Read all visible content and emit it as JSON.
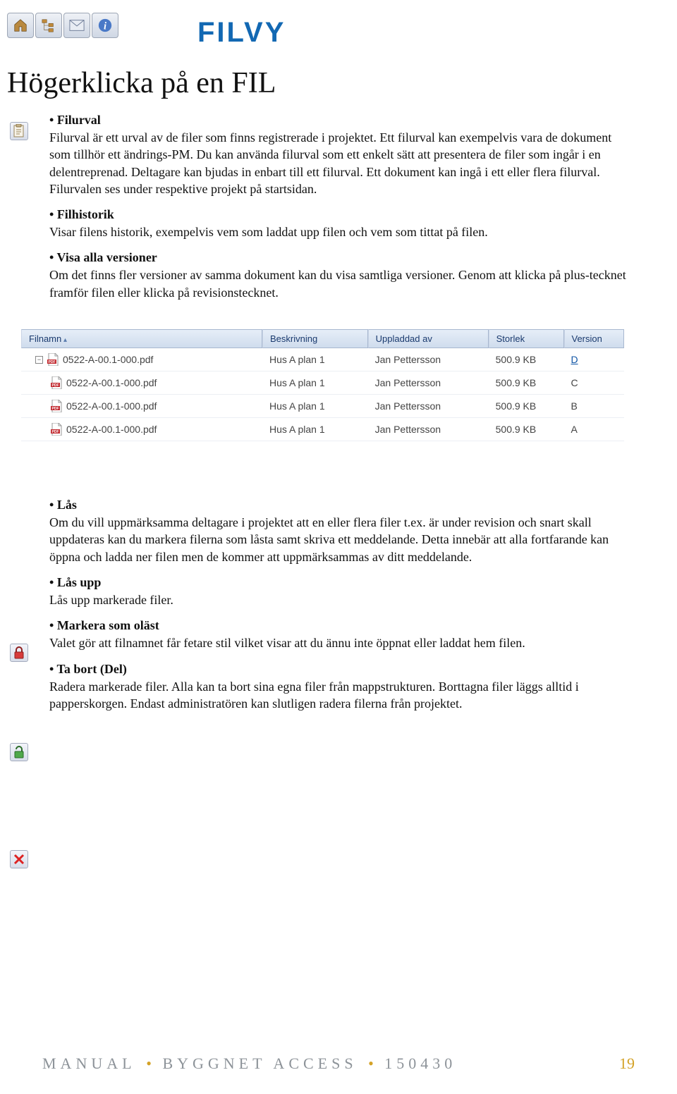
{
  "header": {
    "title": "FILVY"
  },
  "h1": "Högerklicka på en FIL",
  "sections": [
    {
      "title": "Filurval",
      "body": "Filurval är ett urval av de filer som finns registrerade i projektet. Ett filurval kan exempelvis vara de dokument som tillhör ett ändrings-PM. Du kan använda filurval som ett enkelt sätt att presentera de filer som ingår i en delentreprenad. Deltagare kan bjudas in enbart till ett filurval. Ett dokument kan ingå i ett eller flera filurval. Filurvalen ses under respektive projekt på startsidan."
    },
    {
      "title": "Filhistorik",
      "body": "Visar filens historik, exempelvis vem som laddat upp filen och vem som tittat på filen."
    },
    {
      "title": "Visa alla versioner",
      "body": "Om det finns fler versioner av samma dokument kan du visa samtliga versioner. Genom att klicka på plus-tecknet framför filen eller klicka på revisionstecknet."
    }
  ],
  "table": {
    "columns": [
      "Filnamn",
      "Beskrivning",
      "Uppladdad av",
      "Storlek",
      "Version"
    ],
    "rows": [
      {
        "expandable": true,
        "indent": 0,
        "name": "0522-A-00.1-000.pdf",
        "desc": "Hus A plan 1",
        "by": "Jan Pettersson",
        "size": "500.9 KB",
        "ver": "D",
        "verlink": true
      },
      {
        "expandable": false,
        "indent": 1,
        "name": "0522-A-00.1-000.pdf",
        "desc": "Hus A plan 1",
        "by": "Jan Pettersson",
        "size": "500.9 KB",
        "ver": "C"
      },
      {
        "expandable": false,
        "indent": 1,
        "name": "0522-A-00.1-000.pdf",
        "desc": "Hus A plan 1",
        "by": "Jan Pettersson",
        "size": "500.9 KB",
        "ver": "B"
      },
      {
        "expandable": false,
        "indent": 1,
        "name": "0522-A-00.1-000.pdf",
        "desc": "Hus A plan 1",
        "by": "Jan Pettersson",
        "size": "500.9 KB",
        "ver": "A"
      }
    ]
  },
  "sections2": [
    {
      "title": "Lås",
      "body": "Om du vill uppmärksamma deltagare i projektet att en eller flera filer t.ex. är under revision och snart skall uppdateras kan du markera filerna som låsta samt skriva ett meddelande. Detta innebär att alla fortfarande kan öppna och ladda ner filen men de kommer att uppmärksammas av ditt meddelande."
    },
    {
      "title": "Lås upp",
      "body": "Lås upp markerade filer."
    },
    {
      "title": "Markera som oläst",
      "body": "Valet gör att filnamnet får fetare stil vilket visar att du ännu inte öppnat eller laddat hem filen."
    },
    {
      "title": "Ta bort (Del)",
      "body": "Radera markerade filer. Alla kan ta bort sina egna filer från mappstrukturen. Borttagna filer läggs alltid i papperskorgen. Endast administratören kan slutligen radera filerna från projektet."
    }
  ],
  "footer": {
    "left1": "MANUAL",
    "left2": "BYGGNET ACCESS",
    "left3": "150430",
    "page": "19"
  }
}
